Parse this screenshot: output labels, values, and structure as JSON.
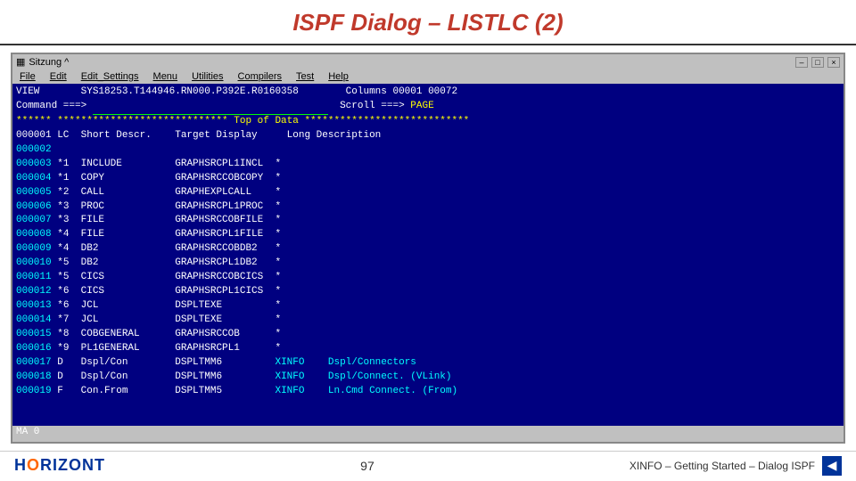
{
  "title": "ISPF Dialog – LISTLC (2)",
  "window": {
    "titlebar": "Sitzung ^",
    "menu_items": [
      "File",
      "Edit",
      "Edit_Settings",
      "Menu",
      "Utilities",
      "Compilers",
      "Test",
      "Help"
    ]
  },
  "ispf": {
    "view_line": "VIEW       SYS18253.T144946.RN000.P392E.R0160358        Columns 00001 00072",
    "command_line": "Command ===>                                              Scroll ===> PAGE",
    "top_of_data": "****** ***************************** Top of Data ****************************",
    "header_line": "000001 LC  Short Descr.    Target Display     Long Description",
    "rows": [
      {
        "num": "000002",
        "content": ""
      },
      {
        "num": "000003",
        "lc": "*1",
        "desc": "INCLUDE",
        "target": "GRAPHSRCPL1INCL",
        "long": "*"
      },
      {
        "num": "000004",
        "lc": "*1",
        "desc": "COPY",
        "target": "GRAPHSRCCOBCOPY",
        "long": "*"
      },
      {
        "num": "000005",
        "lc": "*2",
        "desc": "CALL",
        "target": "GRAPHEXPLCALL",
        "long": "*"
      },
      {
        "num": "000006",
        "lc": "*3",
        "desc": "PROC",
        "target": "GRAPHSRCPL1PROC",
        "long": "*"
      },
      {
        "num": "000007",
        "lc": "*3",
        "desc": "FILE",
        "target": "GRAPHSRCCOBFILE",
        "long": "*"
      },
      {
        "num": "000008",
        "lc": "*4",
        "desc": "FILE",
        "target": "GRAPHSRCPL1FILE",
        "long": "*"
      },
      {
        "num": "000009",
        "lc": "*4",
        "desc": "DB2",
        "target": "GRAPHSRCCOBDB2",
        "long": "*"
      },
      {
        "num": "000010",
        "lc": "*5",
        "desc": "DB2",
        "target": "GRAPHSRCPL1DB2",
        "long": "*"
      },
      {
        "num": "000011",
        "lc": "*5",
        "desc": "CICS",
        "target": "GRAPHSRCCOBCICS",
        "long": "*"
      },
      {
        "num": "000012",
        "lc": "*6",
        "desc": "CICS",
        "target": "GRAPHSRCPL1CICS",
        "long": "*"
      },
      {
        "num": "000013",
        "lc": "*6",
        "desc": "JCL",
        "target": "DSPLTEXE",
        "long": "*"
      },
      {
        "num": "000014",
        "lc": "*7",
        "desc": "JCL",
        "target": "DSPLTEXE",
        "long": "*"
      },
      {
        "num": "000015",
        "lc": "*8",
        "desc": "COBGENERAL",
        "target": "GRAPHSRCCOB",
        "long": "*"
      },
      {
        "num": "000016",
        "lc": "*9",
        "desc": "PL1GENERAL",
        "target": "GRAPHSRCPL1",
        "long": "*"
      },
      {
        "num": "000017",
        "lc": "D",
        "desc": "Dspl/Con",
        "target": "DSPLTMM6",
        "xinfo": "XINFO",
        "long": "Dspl/Connectors"
      },
      {
        "num": "000018",
        "lc": "D",
        "desc": "Dspl/Con",
        "target": "DSPLTMM6",
        "xinfo": "XINFO",
        "long": "Dspl/Connect. (VLink)"
      },
      {
        "num": "000019",
        "lc": "F",
        "desc": "Con.From",
        "target": "DSPLTMM5",
        "xinfo": "XINFO",
        "long": "Ln.Cmd Connect. (From)"
      }
    ],
    "statusbar": "MA   0"
  },
  "footer": {
    "logo": "HORIZONT",
    "page_number": "97",
    "right_text": "XINFO – Getting Started – Dialog ISPF"
  }
}
